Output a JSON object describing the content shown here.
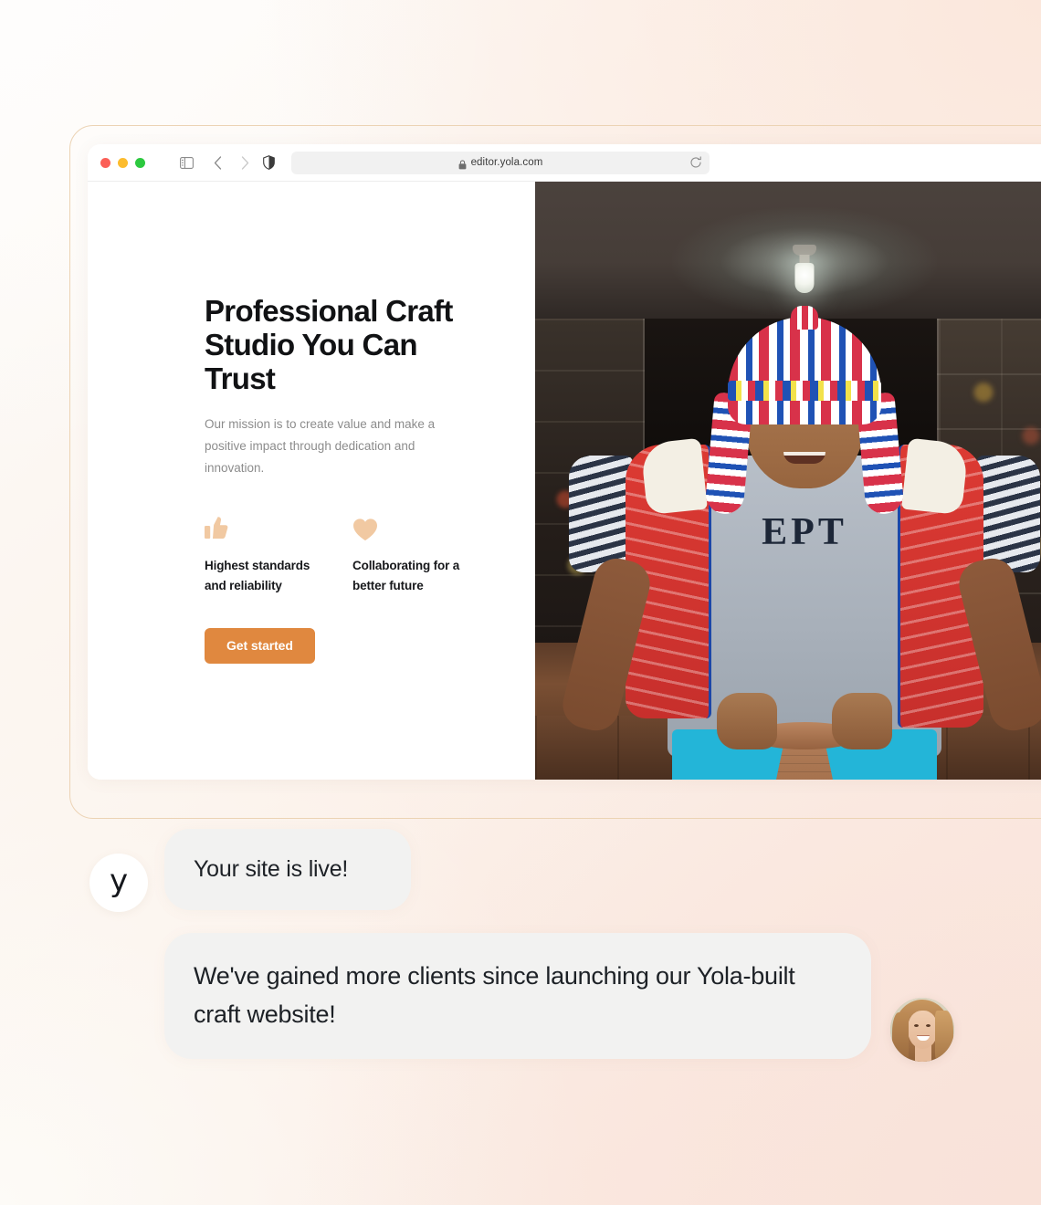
{
  "browser": {
    "traffic_lights": [
      "close",
      "minimize",
      "maximize"
    ],
    "sidebar_icon": "sidebar-toggle-icon",
    "back_icon": "chevron-left-icon",
    "forward_icon": "chevron-right-icon",
    "shield_icon": "privacy-shield-icon",
    "lock_icon": "lock-icon",
    "url": "editor.yola.com",
    "reload_icon": "reload-icon"
  },
  "hero": {
    "title": "Professional Craft Studio You Can Trust",
    "subtitle": "Our mission is to create value and make a positive impact through dedication and innovation.",
    "features": [
      {
        "icon": "thumbs-up-icon",
        "label": "Highest standards and reliability"
      },
      {
        "icon": "heart-icon",
        "label": "Collaborating for a better future"
      }
    ],
    "cta_label": "Get started",
    "photo_alt": "Artisan potter in traditional Andean chullo hat shaping clay on a pottery wheel"
  },
  "chat": {
    "brand_mark": "y",
    "messages": [
      {
        "from": "yola",
        "text": "Your site is live!"
      },
      {
        "from": "customer",
        "text": "We've gained more clients since launching our Yola-built craft website!"
      }
    ],
    "customer_avatar_alt": "Smiling woman with long light-brown hair"
  },
  "colors": {
    "cta_orange": "#e0883f",
    "feature_icon_peach": "#f1c9a2",
    "bubble_gray": "#f2f2f1",
    "frame_tan": "#ecd3b4",
    "heading_dark": "#111214",
    "muted_text": "#8c8c8c"
  }
}
